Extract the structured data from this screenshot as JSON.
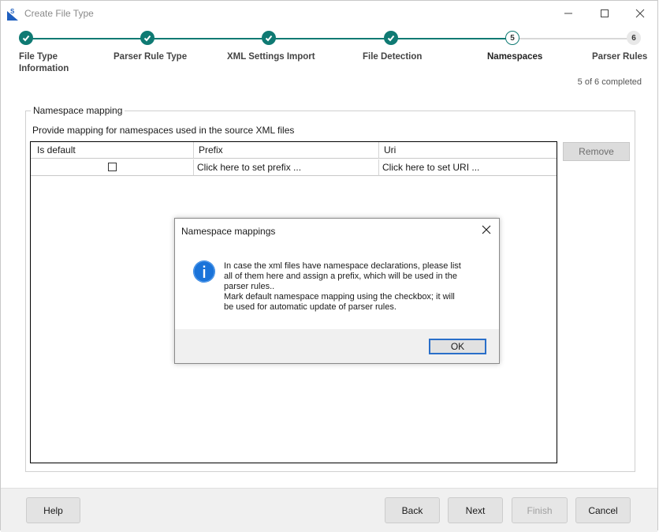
{
  "window": {
    "title": "Create File Type",
    "app_icon": "app-logo-icon",
    "controls": [
      "minimize-icon",
      "maximize-icon",
      "close-icon"
    ]
  },
  "stepper": {
    "progress_text": "5 of 6 completed",
    "accent_color": "#0f7a73",
    "steps": [
      {
        "number": "1",
        "label_line1": "File Type",
        "label_line2": "Information",
        "state": "done"
      },
      {
        "number": "2",
        "label_line1": "Parser Rule Type",
        "label_line2": "",
        "state": "done"
      },
      {
        "number": "3",
        "label_line1": "XML Settings Import",
        "label_line2": "",
        "state": "done"
      },
      {
        "number": "4",
        "label_line1": "File Detection",
        "label_line2": "",
        "state": "done"
      },
      {
        "number": "5",
        "label_line1": "Namespaces",
        "label_line2": "",
        "state": "current"
      },
      {
        "number": "6",
        "label_line1": "Parser Rules",
        "label_line2": "",
        "state": "future"
      }
    ]
  },
  "mapping": {
    "group_title": "Namespace mapping",
    "description": "Provide mapping for namespaces used in the source XML files",
    "columns": [
      "Is default",
      "Prefix",
      "Uri"
    ],
    "row": {
      "is_default": false,
      "prefix": "Click here to set prefix ...",
      "uri": "Click here to set URI ..."
    },
    "remove_label": "Remove"
  },
  "footer": {
    "help": "Help",
    "back": "Back",
    "next": "Next",
    "finish": "Finish",
    "cancel": "Cancel"
  },
  "dialog": {
    "title": "Namespace mappings",
    "icon": "info-icon",
    "line1": "In case the xml files have namespace declarations, please list",
    "line2": "all of them here and assign a prefix, which will be used in the",
    "line3": "parser rules..",
    "line4": "Mark default namespace mapping using the checkbox; it will",
    "line5": "be used for automatic update of parser rules.",
    "ok": "OK"
  }
}
